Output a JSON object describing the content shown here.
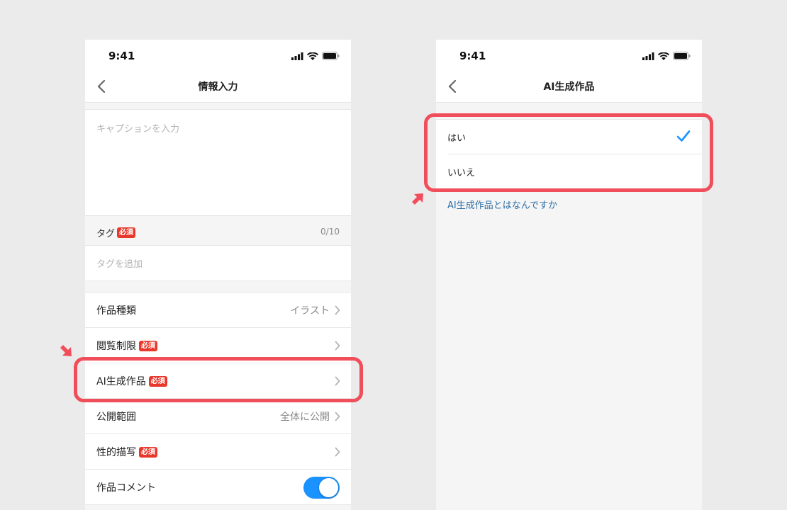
{
  "left_screen": {
    "status_time": "9:41",
    "nav_title": "情報入力",
    "caption_placeholder": "キャプションを入力",
    "tag_label": "タグ",
    "tag_badge": "必須",
    "tag_count": "0/10",
    "tag_placeholder": "タグを追加",
    "rows": [
      {
        "label": "作品種類",
        "value": "イラスト"
      },
      {
        "label": "閲覧制限",
        "badge": "必須"
      },
      {
        "label": "AI生成作品",
        "badge": "必須"
      },
      {
        "label": "公開範囲",
        "value": "全体に公開"
      },
      {
        "label": "性的描写",
        "badge": "必須"
      },
      {
        "label": "作品コメント",
        "toggle_on": true
      }
    ]
  },
  "right_screen": {
    "status_time": "9:41",
    "nav_title": "AI生成作品",
    "options": [
      {
        "label": "はい",
        "selected": true
      },
      {
        "label": "いいえ",
        "selected": false
      }
    ],
    "help_link": "AI生成作品とはなんですか"
  },
  "colors": {
    "accent": "#1a92ff",
    "badge": "#e8382b",
    "highlight": "#f04e5a",
    "link": "#2e6fa6"
  }
}
